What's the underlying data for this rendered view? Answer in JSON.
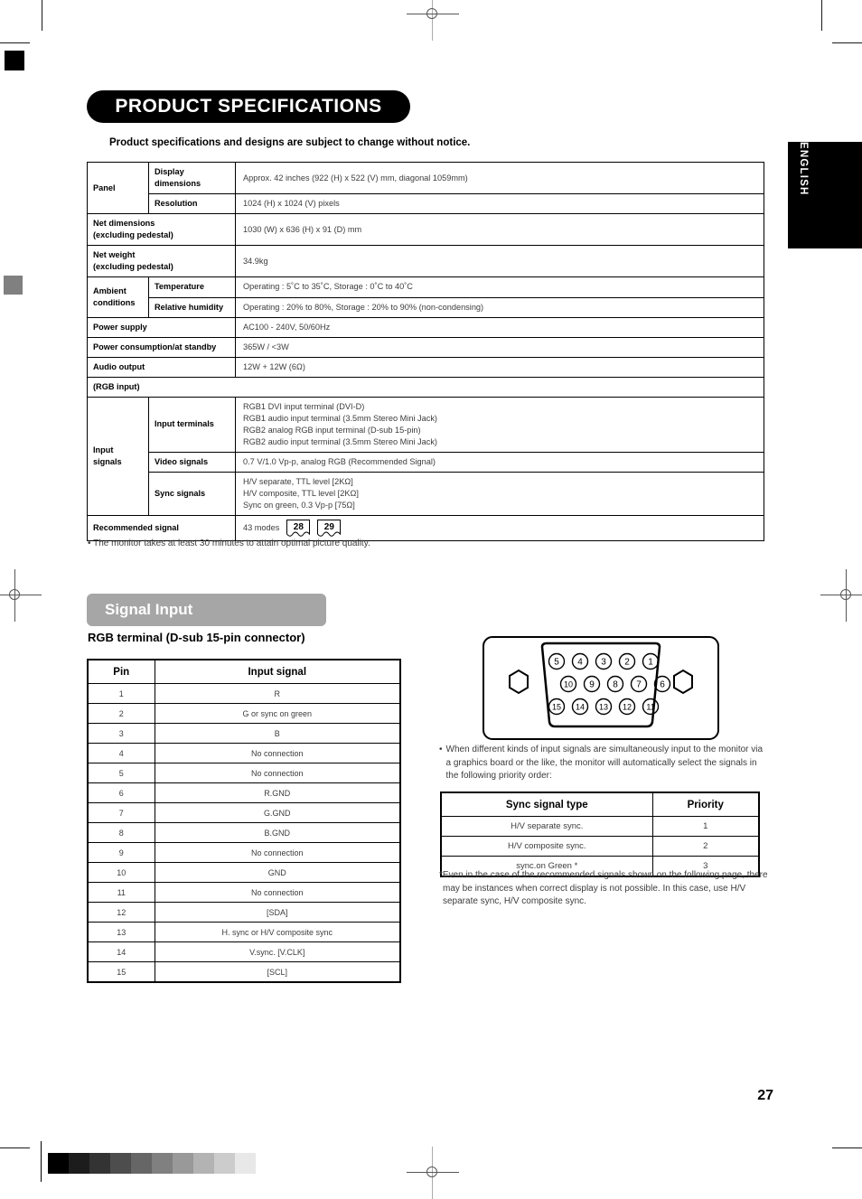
{
  "page": {
    "title": "PRODUCT SPECIFICATIONS",
    "lead_note": "Product specifications and designs are subject to change without notice.",
    "side_tab": "ENGLISH",
    "page_number": "27",
    "colors": {
      "title_pill": "#000000",
      "banner": "#a6a6a6",
      "text": "#3c3c3c"
    }
  },
  "spec_table": {
    "rows": [
      {
        "group": "Panel",
        "label": "Display\ndimensions",
        "value": "Approx. 42 inches (922 (H) x 522 (V) mm, diagonal 1059mm)"
      },
      {
        "group": "",
        "label": "Resolution",
        "value": "1024 (H) x 1024 (V) pixels"
      },
      {
        "group": "",
        "label": "Net dimensions\n(excluding pedestal)",
        "value": "1030 (W) x 636 (H) x 91 (D) mm"
      },
      {
        "group": "",
        "label": "Net weight\n(excluding pedestal)",
        "value": "34.9kg"
      },
      {
        "group": "Ambient\nconditions",
        "label": "Temperature",
        "value": "Operating : 5˚C to 35˚C, Storage : 0˚C to 40˚C"
      },
      {
        "group": "",
        "label": "Relative humidity",
        "value": "Operating : 20% to 80%, Storage : 20% to 90% (non-condensing)"
      },
      {
        "group": "",
        "label": "Power supply",
        "value": "AC100 - 240V, 50/60Hz"
      },
      {
        "group": "",
        "label": "Power consumption/at standby",
        "value": "365W / <3W"
      },
      {
        "group": "",
        "label": "Audio output",
        "value": "12W + 12W (6Ω)"
      },
      {
        "group": "",
        "label": "(RGB input)",
        "value": ""
      },
      {
        "group": "Input signals",
        "label": "Input terminals",
        "value": "RGB1 DVI input terminal (DVI-D)\nRGB1 audio input terminal (3.5mm Stereo Mini Jack)\nRGB2 analog RGB input terminal (D-sub 15-pin)\nRGB2 audio input terminal (3.5mm Stereo Mini Jack)"
      },
      {
        "group": "",
        "label": "Video signals",
        "value": "0.7 V/1.0 Vp-p, analog RGB (Recommended Signal)"
      },
      {
        "group": "",
        "label": "Sync signals",
        "value": "H/V separate, TTL level [2KΩ]\nH/V composite, TTL level [2KΩ]\nSync on green, 0.3 Vp-p [75Ω]"
      },
      {
        "group": "",
        "label": "Recommended signal",
        "value": "43 modes"
      }
    ],
    "panel_label": "Panel",
    "ambient_label": "Ambient\nconditions",
    "input_signals_label": "Input signals",
    "recommended_prefix": "43 modes",
    "page_refs": [
      "28",
      "29"
    ]
  },
  "after_table_note": "• The monitor takes at least 30 minutes to attain optimal picture quality.",
  "signal_input": {
    "banner": "Signal Input",
    "sub_heading": "RGB terminal (D-sub 15-pin connector)",
    "pin_table": {
      "headers": [
        "Pin",
        "Input signal"
      ],
      "rows": [
        [
          "1",
          "R"
        ],
        [
          "2",
          "G or sync on green"
        ],
        [
          "3",
          "B"
        ],
        [
          "4",
          "No connection"
        ],
        [
          "5",
          "No connection"
        ],
        [
          "6",
          "R.GND"
        ],
        [
          "7",
          "G.GND"
        ],
        [
          "8",
          "B.GND"
        ],
        [
          "9",
          "No connection"
        ],
        [
          "10",
          "GND"
        ],
        [
          "11",
          "No connection"
        ],
        [
          "12",
          "[SDA]"
        ],
        [
          "13",
          "H. sync or H/V composite sync"
        ],
        [
          "14",
          "V.sync. [V.CLK]"
        ],
        [
          "15",
          "[SCL]"
        ]
      ]
    },
    "connector_diagram": {
      "row_top": [
        "5",
        "4",
        "3",
        "2",
        "1"
      ],
      "row_mid": [
        "10",
        "9",
        "8",
        "7",
        "6"
      ],
      "row_bottom": [
        "15",
        "14",
        "13",
        "12",
        "11"
      ]
    },
    "priority_note": "When different kinds of input signals are simultaneously input to the monitor via a graphics board or the like, the monitor will automatically select the signals in the following priority order:",
    "priority_table": {
      "headers": [
        "Sync signal type",
        "Priority"
      ],
      "rows": [
        [
          "H/V separate sync.",
          "1"
        ],
        [
          "H/V composite sync.",
          "2"
        ],
        [
          "sync.on Green *",
          "3"
        ]
      ]
    },
    "footnote": "*Even in the case of the recommended signals shown on the following page, there may be instances when correct display is not possible. In this case, use H/V separate sync, H/V composite sync."
  },
  "colorbar": [
    "#000000",
    "#1c1c1c",
    "#333333",
    "#4d4d4d",
    "#666666",
    "#808080",
    "#999999",
    "#b3b3b3",
    "#cccccc",
    "#e8e8e8"
  ]
}
